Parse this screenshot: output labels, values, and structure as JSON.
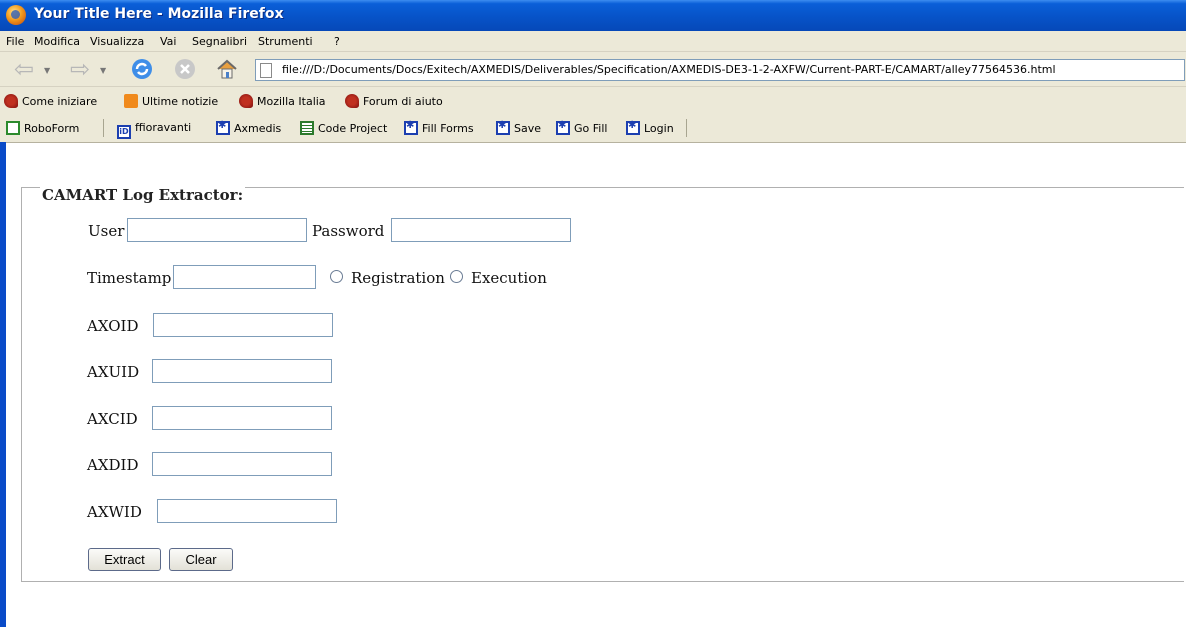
{
  "window": {
    "title": "Your Title Here - Mozilla Firefox"
  },
  "menu": [
    "File",
    "Modifica",
    "Visualizza",
    "Vai",
    "Segnalibri",
    "Strumenti",
    "?"
  ],
  "nav": {
    "url": "file:///D:/Documents/Docs/Exitech/AXMEDIS/Deliverables/Specification/AXMEDIS-DE3-1-2-AXFW/Current-PART-E/CAMART/alley77564536.html"
  },
  "bookmarks": [
    "Come iniziare",
    "Ultime notizie",
    "Mozilla Italia",
    "Forum di aiuto"
  ],
  "roboform": [
    "RoboForm",
    "ffioravanti",
    "Axmedis",
    "Code Project",
    "Fill Forms",
    "Save",
    "Go Fill",
    "Login"
  ],
  "form": {
    "legend": "CAMART Log Extractor:",
    "user_label": "User",
    "password_label": "Password",
    "timestamp_label": "Timestamp",
    "registration_label": "Registration",
    "execution_label": "Execution",
    "axoid_label": "AXOID",
    "axuid_label": "AXUID",
    "axcid_label": "AXCID",
    "axdid_label": "AXDID",
    "axwid_label": "AXWID",
    "extract_label": "Extract",
    "clear_label": "Clear"
  }
}
